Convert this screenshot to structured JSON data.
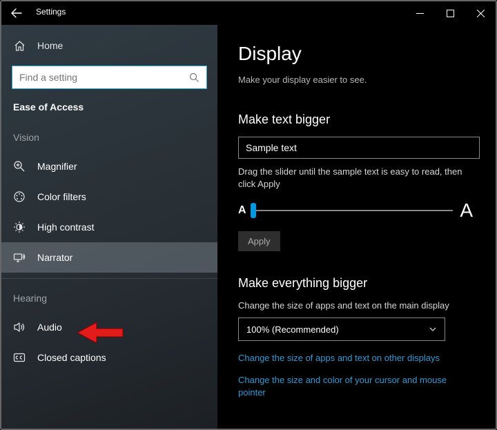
{
  "titlebar": {
    "title": "Settings"
  },
  "sidebar": {
    "home_label": "Home",
    "search_placeholder": "Find a setting",
    "section": "Ease of Access",
    "cat_vision": "Vision",
    "items_vision": [
      {
        "label": "Magnifier"
      },
      {
        "label": "Color filters"
      },
      {
        "label": "High contrast"
      },
      {
        "label": "Narrator"
      }
    ],
    "cat_hearing": "Hearing",
    "items_hearing": [
      {
        "label": "Audio"
      },
      {
        "label": "Closed captions"
      }
    ]
  },
  "content": {
    "h1": "Display",
    "sub": "Make your display easier to see.",
    "text_bigger": {
      "heading": "Make text bigger",
      "sample": "Sample text",
      "help": "Drag the slider until the sample text is easy to read, then click Apply",
      "small_A": "A",
      "big_A": "A",
      "apply": "Apply"
    },
    "everything_bigger": {
      "heading": "Make everything bigger",
      "desc": "Change the size of apps and text on the main display",
      "dropdown_value": "100% (Recommended)",
      "link1": "Change the size of apps and text on other displays",
      "link2": "Change the size and color of your cursor and mouse pointer"
    }
  }
}
